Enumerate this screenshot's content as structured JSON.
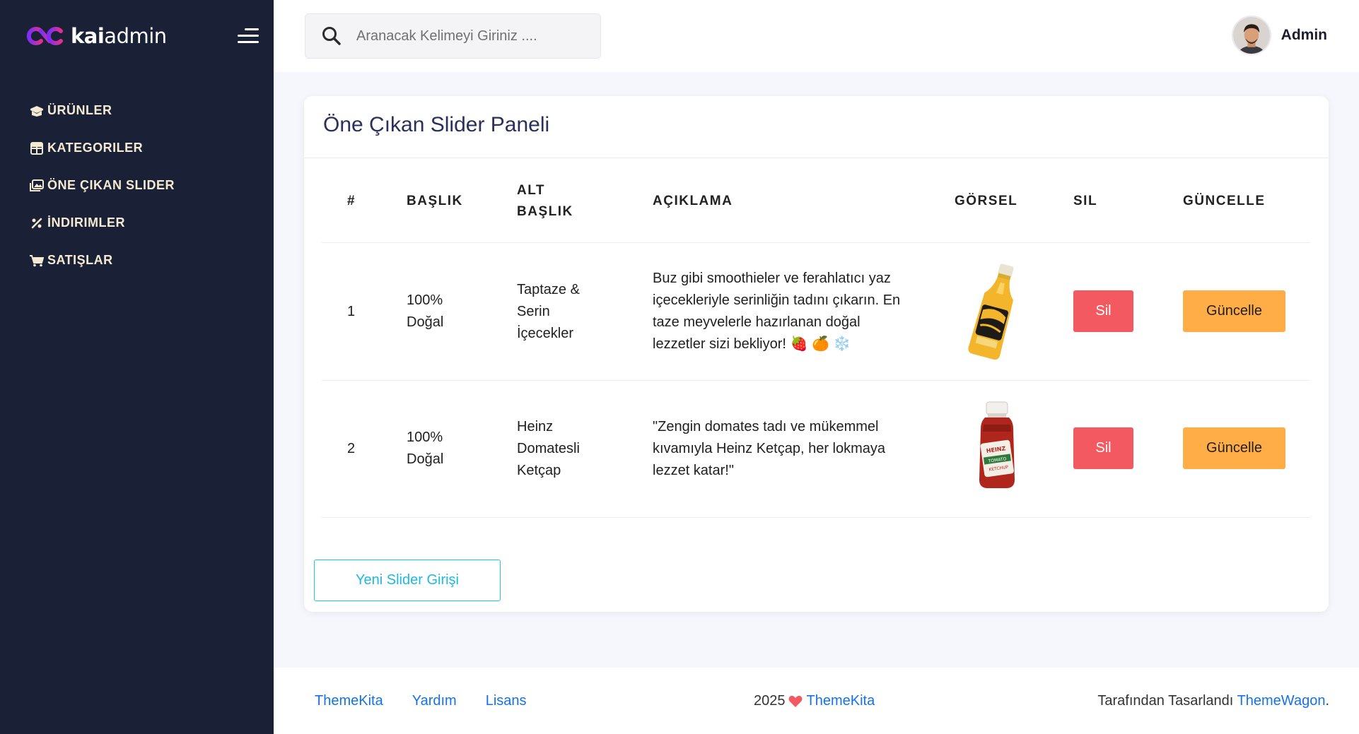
{
  "brand": {
    "logo_part1": "kai",
    "logo_part2": "admin"
  },
  "sidebar": {
    "items": [
      {
        "label": "ÜRÜNLER",
        "icon": "box-open-icon"
      },
      {
        "label": "KATEGORILER",
        "icon": "th-large-icon"
      },
      {
        "label": "ÖNE ÇIKAN SLIDER",
        "icon": "images-icon"
      },
      {
        "label": "İNDIRIMLER",
        "icon": "percent-icon"
      },
      {
        "label": "SATIŞLAR",
        "icon": "shopping-cart-icon"
      }
    ]
  },
  "header": {
    "search_placeholder": "Aranacak Kelimeyi Giriniz ....",
    "user_name": "Admin"
  },
  "panel": {
    "title": "Öne Çıkan Slider Paneli",
    "columns": [
      "#",
      "BAŞLIK",
      "ALT BAŞLIK",
      "AÇIKLAMA",
      "GÖRSEL",
      "SIL",
      "GÜNCELLE"
    ],
    "rows": [
      {
        "id": "1",
        "title": "100% Doğal",
        "subtitle": "Taptaze & Serin İçecekler",
        "description": "Buz gibi smoothieler ve ferahlatıcı yaz içecekleriyle serinliğin tadını çıkarın. En taze meyvelerle hazırlanan doğal lezzetler sizi bekliyor! 🍓 🍊 ❄️",
        "image": "juice-bottle",
        "delete_label": "Sil",
        "update_label": "Güncelle"
      },
      {
        "id": "2",
        "title": "100% Doğal",
        "subtitle": "Heinz Domatesli Ketçap",
        "description": "\"Zengin domates tadı ve mükemmel kıvamıyla Heinz Ketçap, her lokmaya lezzet katar!\"",
        "image": "ketchup-jar",
        "delete_label": "Sil",
        "update_label": "Güncelle"
      }
    ],
    "new_button_label": "Yeni Slider Girişi"
  },
  "footer": {
    "links": [
      "ThemeKita",
      "Yardım",
      "Lisans"
    ],
    "year": "2025",
    "center_link": "ThemeKita",
    "designed_by_text": "Tarafından Tasarlandı",
    "designer_link": "ThemeWagon",
    "designer_suffix": "."
  },
  "colors": {
    "sidebar_bg": "#1a2035",
    "danger": "#f25961",
    "warning": "#ffad46",
    "info": "#1fc3e4",
    "link": "#1572e8"
  }
}
